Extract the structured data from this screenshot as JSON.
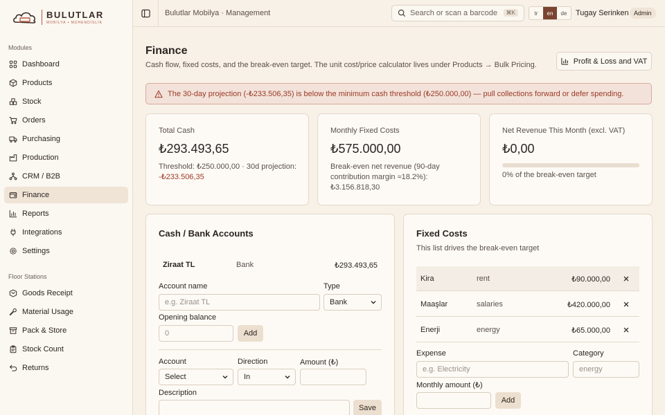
{
  "brand": {
    "name": "BULUTLAR",
    "subtitle": "MOBİLYA • MÜHENDİSLİK"
  },
  "sidebar": {
    "modules_label": "Modules",
    "modules": [
      {
        "label": "Dashboard",
        "icon": "dashboard-icon"
      },
      {
        "label": "Products",
        "icon": "box-icon"
      },
      {
        "label": "Stock",
        "icon": "boxes-icon"
      },
      {
        "label": "Orders",
        "icon": "cart-icon"
      },
      {
        "label": "Purchasing",
        "icon": "truck-icon"
      },
      {
        "label": "Production",
        "icon": "factory-icon"
      },
      {
        "label": "CRM / B2B",
        "icon": "network-icon"
      },
      {
        "label": "Finance",
        "icon": "wallet-icon",
        "active": true
      },
      {
        "label": "Reports",
        "icon": "bar-chart-icon"
      },
      {
        "label": "Integrations",
        "icon": "plug-icon"
      },
      {
        "label": "Settings",
        "icon": "gear-icon"
      }
    ],
    "floor_label": "Floor Stations",
    "floor": [
      {
        "label": "Goods Receipt",
        "icon": "package-in-icon"
      },
      {
        "label": "Material Usage",
        "icon": "wrench-icon"
      },
      {
        "label": "Pack & Store",
        "icon": "archive-icon"
      },
      {
        "label": "Stock Count",
        "icon": "clipboard-icon"
      },
      {
        "label": "Returns",
        "icon": "return-icon"
      }
    ]
  },
  "topbar": {
    "breadcrumb": "Bulutlar Mobilya · Management",
    "search_placeholder": "Search or scan a barcode",
    "search_shortcut": "⌘K",
    "languages": [
      "tr",
      "en",
      "de"
    ],
    "active_language": "en",
    "user_name": "Tugay Serinken",
    "role": "Admin"
  },
  "page": {
    "title": "Finance",
    "subtitle": "Cash flow, fixed costs, and the break-even target. The unit cost/price calculator lives under Products → Bulk Pricing.",
    "pnl_button": "Profit & Loss and VAT",
    "alert": "The 30-day projection (-₺233.506,35) is below the minimum cash threshold (₺250.000,00) — pull collections forward or defer spending."
  },
  "kpis": {
    "cash": {
      "label": "Total Cash",
      "value": "₺293.493,65",
      "note": "Threshold: ₺250.000,00 · 30d projection:",
      "projection": "-₺233.506,35"
    },
    "fixed": {
      "label": "Monthly Fixed Costs",
      "value": "₺575.000,00",
      "note": "Break-even net revenue (90-day contribution margin ≈18.2%): ₺3.156.818,30"
    },
    "revenue": {
      "label": "Net Revenue This Month (excl. VAT)",
      "value": "₺0,00",
      "progress": 0,
      "progress_label": "0% of the break-even target"
    }
  },
  "accounts": {
    "title": "Cash / Bank Accounts",
    "rows": [
      {
        "name": "Ziraat TL",
        "type": "Bank",
        "balance": "₺293.493,65"
      }
    ],
    "form": {
      "name_label": "Account name",
      "name_placeholder": "e.g. Ziraat TL",
      "type_label": "Type",
      "type_value": "Bank",
      "opening_label": "Opening balance",
      "opening_placeholder": "0",
      "add_label": "Add"
    },
    "txn": {
      "account_label": "Account",
      "account_value": "Select",
      "direction_label": "Direction",
      "direction_value": "In",
      "amount_label": "Amount (₺)",
      "description_label": "Description",
      "save_label": "Save"
    }
  },
  "fixed_costs": {
    "title": "Fixed Costs",
    "subtitle": "This list drives the break-even target",
    "rows": [
      {
        "name": "Kira",
        "category": "rent",
        "amount": "₺90.000,00"
      },
      {
        "name": "Maaşlar",
        "category": "salaries",
        "amount": "₺420.000,00"
      },
      {
        "name": "Enerji",
        "category": "energy",
        "amount": "₺65.000,00"
      }
    ],
    "form": {
      "expense_label": "Expense",
      "expense_placeholder": "e.g. Electricity",
      "category_label": "Category",
      "category_placeholder": "energy",
      "amount_label": "Monthly amount (₺)",
      "add_label": "Add"
    }
  },
  "colors": {
    "accent": "#7a4431",
    "background": "#f8f1e8",
    "alert_text": "#9a3a26",
    "negative": "#a13a24"
  }
}
